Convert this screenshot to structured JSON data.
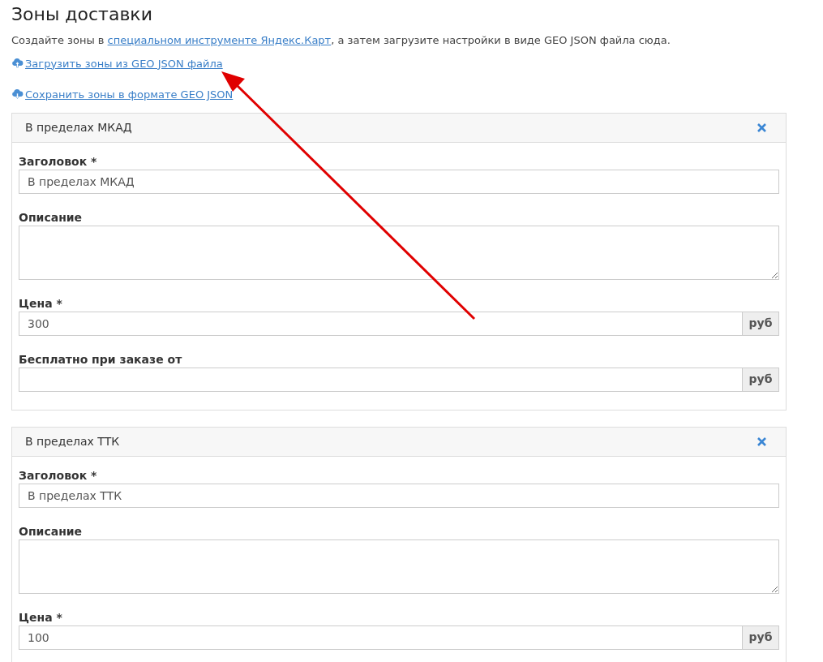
{
  "title": "Зоны доставки",
  "intro": {
    "before": "Создайте зоны в ",
    "link": "специальном инструменте Яндекс.Карт",
    "after": ", а затем загрузите настройки в виде GEO JSON файла сюда."
  },
  "actions": [
    {
      "kind": "upload",
      "label": "Загрузить зоны из GEO JSON файла"
    },
    {
      "kind": "download",
      "label": "Сохранить зоны в формате GEO JSON"
    }
  ],
  "zones": [
    {
      "name": "В пределах МКАД",
      "fields": [
        {
          "kind": "text",
          "label": "Заголовок *",
          "value": "В пределах МКАД"
        },
        {
          "kind": "textarea",
          "label": "Описание"
        },
        {
          "kind": "money",
          "label": "Цена *",
          "value": "300",
          "unit": "руб"
        },
        {
          "kind": "money",
          "label": "Бесплатно при заказе от",
          "unit": "руб"
        }
      ]
    },
    {
      "name": "В пределах ТТК",
      "fields": [
        {
          "kind": "text",
          "label": "Заголовок *",
          "value": "В пределах ТТК"
        },
        {
          "kind": "textarea",
          "label": "Описание"
        },
        {
          "kind": "money",
          "label": "Цена *",
          "value": "100",
          "unit": "руб"
        }
      ]
    }
  ],
  "annotation": {
    "kind": "arrow",
    "color": "#e00000"
  }
}
